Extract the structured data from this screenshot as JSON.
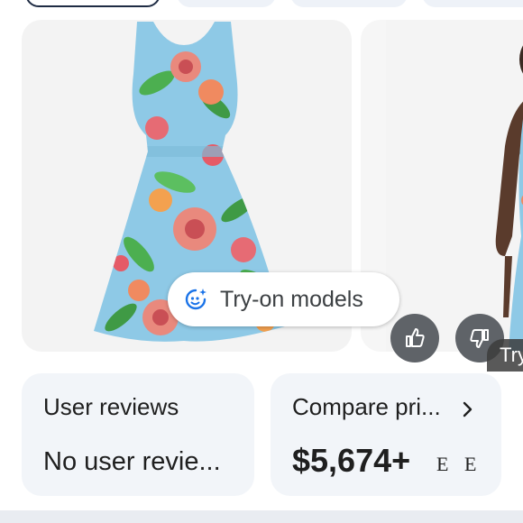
{
  "carousel": {
    "tryon_chip_label": "Try-on models",
    "tryon_tag_label": "Try-o",
    "icons": {
      "sparkle_face": "sparkle-face-icon",
      "thumbs_up": "thumbs-up-icon",
      "thumbs_down": "thumbs-down-icon"
    }
  },
  "reviews_card": {
    "title": "User reviews",
    "value": "No user revie..."
  },
  "compare_card": {
    "title": "Compare pri...",
    "price": "$5,674+",
    "store_logos": "E E"
  },
  "colors": {
    "accent_blue": "#1a73e8",
    "card_bg": "#f2f5f9",
    "button_gray": "#5f6368",
    "dress_blue": "#8ec9e6"
  }
}
